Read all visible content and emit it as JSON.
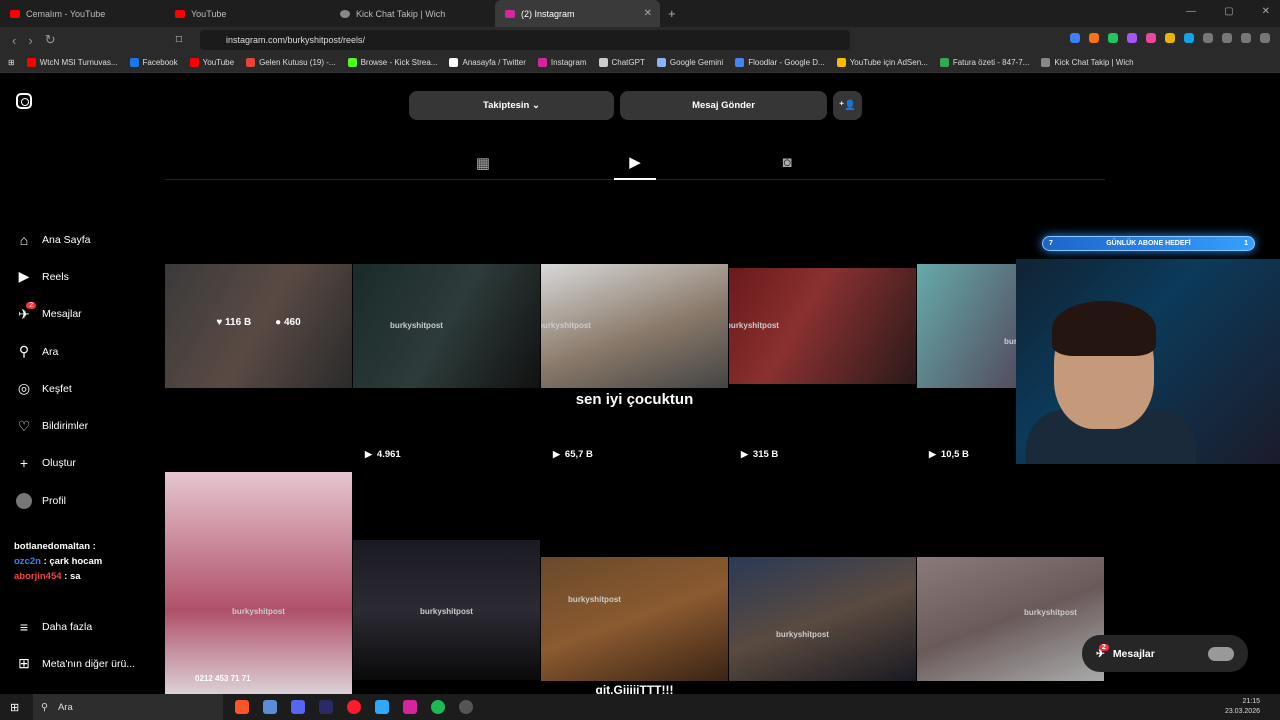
{
  "browser": {
    "tabs": [
      {
        "title": "Cemalım - YouTube",
        "active": false
      },
      {
        "title": "YouTube",
        "active": false
      },
      {
        "title": "Kick Chat Takip | Wich",
        "active": false
      },
      {
        "title": "(2) Instagram",
        "active": true
      }
    ],
    "url": "instagram.com/burkyshitpost/reels/",
    "bookmarks": [
      "WtcN MSI Turnuvas...",
      "Facebook",
      "YouTube",
      "Gelen Kutusu (19) -...",
      "Browse - Kick Strea...",
      "Anasayfa / Twitter",
      "Instagram",
      "ChatGPT",
      "Google Gemini",
      "Floodlar - Google D...",
      "YouTube için AdSen...",
      "Fatura özeti - 847-7...",
      "Kick Chat Takip | Wich"
    ]
  },
  "sidebar": {
    "items": [
      {
        "label": "Ana Sayfa",
        "icon": "home-icon"
      },
      {
        "label": "Reels",
        "icon": "reels-icon"
      },
      {
        "label": "Mesajlar",
        "icon": "messages-icon",
        "badge": "2"
      },
      {
        "label": "Ara",
        "icon": "search-icon"
      },
      {
        "label": "Keşfet",
        "icon": "compass-icon"
      },
      {
        "label": "Bildirimler",
        "icon": "heart-icon"
      },
      {
        "label": "Oluştur",
        "icon": "plus-icon"
      },
      {
        "label": "Profil",
        "icon": "avatar-icon"
      }
    ],
    "bottom": [
      {
        "label": "Daha fazla",
        "icon": "menu-icon"
      },
      {
        "label": "Meta'nın diğer ürü...",
        "icon": "meta-icon"
      }
    ]
  },
  "chat_overlay": [
    {
      "user": "botlanedomaltan",
      "text": ":"
    },
    {
      "user": "ozc2n",
      "text": ": çark hocam"
    },
    {
      "user": "aborjin454",
      "text": ": sa"
    }
  ],
  "profile": {
    "follow_label": "Takiptesin",
    "message_label": "Mesaj Gönder"
  },
  "reels": [
    {
      "views": "",
      "likes": "116 B",
      "comments": "460",
      "watermark": "",
      "caption": ""
    },
    {
      "views": "4.961",
      "watermark": "burkyshitpost",
      "caption": ""
    },
    {
      "views": "65,7 B",
      "watermark": "burkyshitpost",
      "caption": "sen iyi çocuktun"
    },
    {
      "views": "315 B",
      "watermark": "burkyshitpost",
      "caption": ""
    },
    {
      "views": "10,5 B",
      "watermark": "burkyshitpost",
      "caption": ""
    },
    {
      "views": "",
      "watermark": "burkyshitpost",
      "caption": "",
      "phone": "0212 453 71 71"
    },
    {
      "views": "",
      "watermark": "burkyshitpost",
      "caption": ""
    },
    {
      "views": "",
      "watermark": "burkyshitpost",
      "caption": "git.GiiiiiTTT!!!"
    },
    {
      "views": "",
      "watermark": "burkyshitpost",
      "caption": ""
    },
    {
      "views": "",
      "watermark": "burkyshitpost",
      "caption": ""
    }
  ],
  "stream": {
    "goal_label": "GÜNLÜK ABONE HEDEFİ",
    "goal_current": "7",
    "goal_target": "1"
  },
  "messages_pill": {
    "label": "Mesajlar",
    "badge": "2"
  },
  "taskbar": {
    "search_placeholder": "Ara",
    "time": "21:15",
    "date": "23.03.2026"
  }
}
